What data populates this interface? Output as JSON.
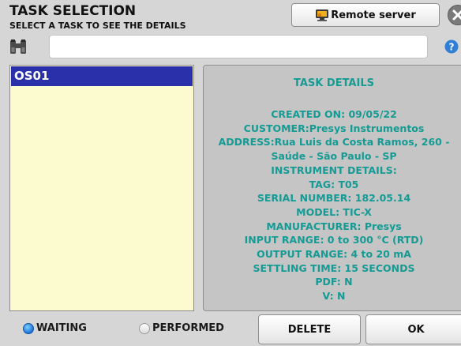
{
  "header": {
    "title": "TASK SELECTION",
    "subtitle": "SELECT A TASK TO SEE THE DETAILS",
    "remote_server_label": "Remote server"
  },
  "search": {
    "value": "",
    "placeholder": ""
  },
  "tasks": [
    {
      "id": "OS01",
      "selected": true
    }
  ],
  "details": {
    "heading": "TASK DETAILS",
    "created_on": "CREATED ON: 09/05/22",
    "customer": "CUSTOMER:Presys Instrumentos",
    "address_1": "ADDRESS:Rua Luis da Costa Ramos, 260 -",
    "address_2": "Saúde - São Paulo - SP",
    "instrument_details": "INSTRUMENT DETAILS:",
    "tag": "TAG: T05",
    "serial_number": "SERIAL NUMBER: 182.05.14",
    "model": "MODEL: TIC-X",
    "manufacturer": "MANUFACTURER: Presys",
    "input_range": "INPUT RANGE: 0 to 300 °C (RTD)",
    "output_range": "OUTPUT RANGE: 4 to 20 mA",
    "settling_time": "SETTLING TIME: 15 SECONDS",
    "pdf": "PDF: N",
    "v": "V: N"
  },
  "filters": {
    "waiting_label": "WAITING",
    "performed_label": "PERFORMED",
    "selected": "waiting"
  },
  "actions": {
    "delete_label": "DELETE",
    "ok_label": "OK"
  },
  "colors": {
    "details_text": "#159b94",
    "selection": "#2a2faa",
    "list_background": "#fcfbd0"
  },
  "icons": {
    "remote_server": "server-icon",
    "close": "close-icon",
    "search": "binoculars-icon",
    "help": "help-icon"
  }
}
